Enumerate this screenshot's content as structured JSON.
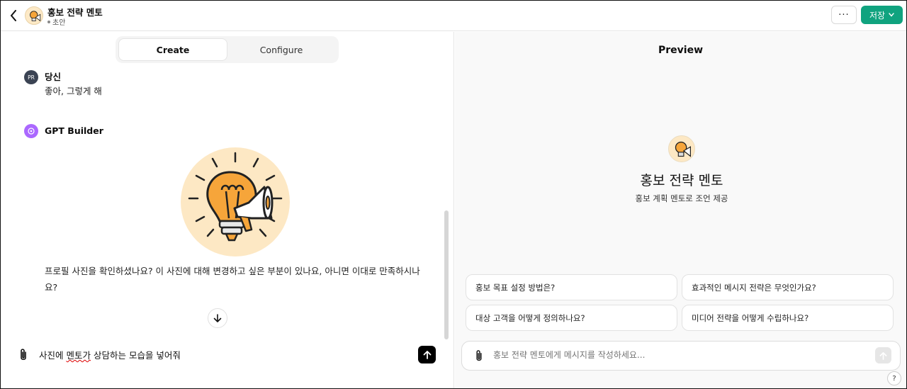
{
  "header": {
    "title": "홍보 전략 멘토",
    "status": "초안",
    "more_label": "···",
    "save_label": "저장"
  },
  "tabs": [
    {
      "label": "Create",
      "active": true
    },
    {
      "label": "Configure",
      "active": false
    }
  ],
  "chat": {
    "user": {
      "avatar_text": "PR",
      "name": "당신",
      "text": "좋아, 그렇게 해"
    },
    "assistant": {
      "name": "GPT Builder",
      "text": "프로필 사진을 확인하셨나요? 이 사진에 대해 변경하고 싶은 부분이 있나요, 아니면 이대로 만족하시나요?"
    }
  },
  "composer": {
    "value_before": "사진에 ",
    "value_typo": "멘토가",
    "value_after": " 상담하는 모습을 넣어줘"
  },
  "preview": {
    "title": "Preview",
    "gpt_name": "홍보 전략 멘토",
    "gpt_description": "홍보 계획 멘토로 조언 제공",
    "starters": [
      "홍보 목표 설정 방법은?",
      "효과적인 메시지 전략은 무엇인가요?",
      "대상 고객을 어떻게 정의하나요?",
      "미디어 전략을 어떻게 수립하나요?"
    ],
    "input_placeholder": "홍보 전략 멘토에게 메시지를 작성하세요...",
    "help_label": "?"
  },
  "colors": {
    "accent": "#10a37f",
    "gpt_icon": "#ab68ff",
    "avatar_bg": "#fde8c4",
    "bulb": "#f6a53a"
  },
  "icons": [
    "back-chevron-icon",
    "bulb-megaphone-icon",
    "gpt-builder-icon",
    "paperclip-icon",
    "send-arrow-icon",
    "arrow-down-icon",
    "chevron-down-icon"
  ]
}
